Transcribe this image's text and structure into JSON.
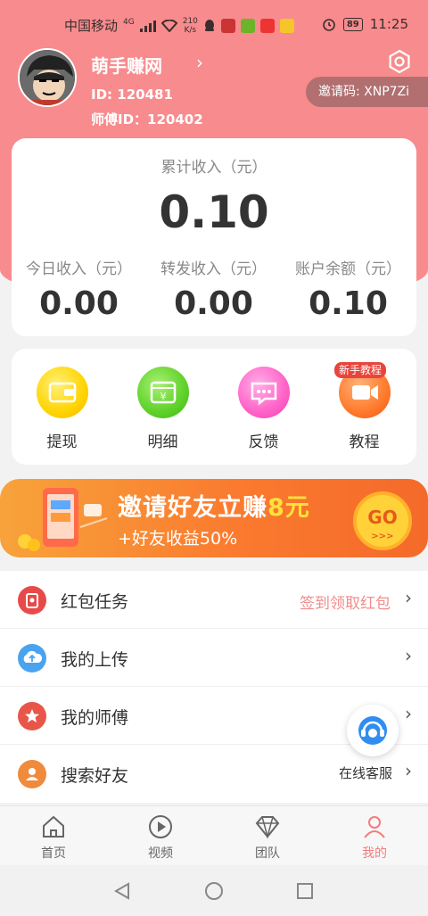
{
  "status_bar": {
    "carrier": "中国移动",
    "network": "4G",
    "speed_value": "210",
    "speed_unit": "K/s",
    "battery": "89",
    "time": "11:25"
  },
  "profile": {
    "username": "萌手赚网",
    "user_id": "ID: 120481",
    "master_id": "师傅ID：120402",
    "invite_code": "邀请码: XNP7Zi"
  },
  "earnings": {
    "total_label": "累计收入（元）",
    "total_value": "0.10",
    "stats": [
      {
        "label": "今日收入（元）",
        "value": "0.00"
      },
      {
        "label": "转发收入（元）",
        "value": "0.00"
      },
      {
        "label": "账户余额（元）",
        "value": "0.10"
      }
    ]
  },
  "actions": [
    {
      "label": "提现",
      "icon": "wallet-icon",
      "color": "#ffd400"
    },
    {
      "label": "明细",
      "icon": "calendar-yuan-icon",
      "color": "#5fd12a"
    },
    {
      "label": "反馈",
      "icon": "chat-bubble-icon",
      "color": "#ff63c8"
    },
    {
      "label": "教程",
      "icon": "video-camera-icon",
      "color": "#ff7a2b",
      "badge": "新手教程"
    }
  ],
  "banner": {
    "title_prefix": "邀请好友立赚",
    "title_amount": "8元",
    "subtitle": "+好友收益50%",
    "go_label": "GO"
  },
  "menu": [
    {
      "label": "红包任务",
      "hint": "签到领取红包",
      "icon": "red-envelope-icon",
      "color": "#e84a4a"
    },
    {
      "label": "我的上传",
      "hint": "",
      "icon": "cloud-upload-icon",
      "color": "#4aa3ef"
    },
    {
      "label": "我的师傅",
      "hint": "",
      "icon": "star-icon",
      "color": "#e8564a"
    },
    {
      "label": "搜索好友",
      "hint": "",
      "icon": "person-icon",
      "color": "#f08a3c"
    }
  ],
  "customer_service": {
    "label": "在线客服"
  },
  "tabbar": [
    {
      "label": "首页",
      "icon": "home-icon",
      "active": false
    },
    {
      "label": "视频",
      "icon": "play-icon",
      "active": false
    },
    {
      "label": "团队",
      "icon": "diamond-icon",
      "active": false
    },
    {
      "label": "我的",
      "icon": "user-icon",
      "active": true
    }
  ],
  "colors": {
    "header": "#f88b8d",
    "accent": "#f47c7c"
  }
}
